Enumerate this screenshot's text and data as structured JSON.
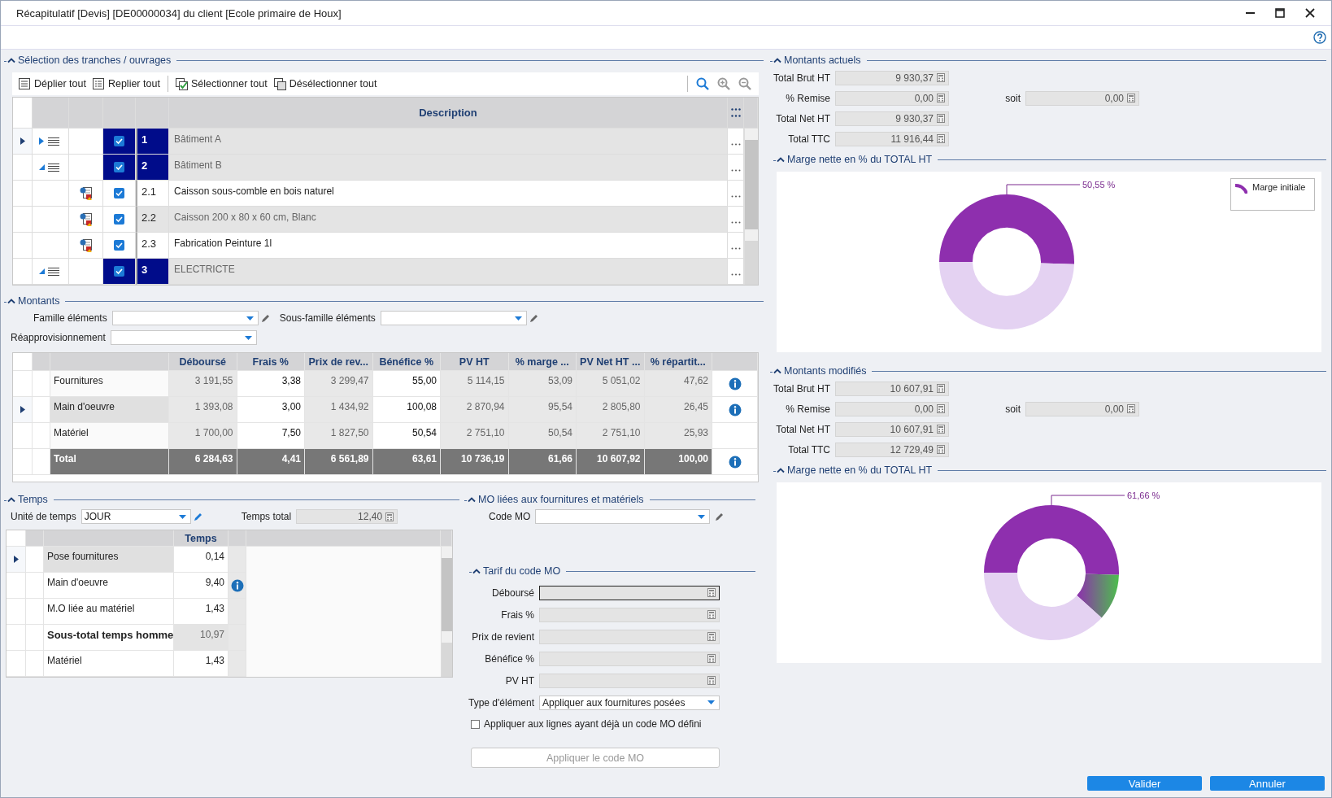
{
  "window": {
    "title": "Récapitulatif [Devis] [DE00000034] du client [Ecole primaire de Houx]"
  },
  "selection": {
    "title": "Sélection des tranches / ouvrages",
    "expanded": true,
    "toolbar": [
      {
        "label": "Déplier tout"
      },
      {
        "label": "Replier tout"
      },
      {
        "label": "Sélectionner tout"
      },
      {
        "label": "Désélectionner tout"
      }
    ],
    "grid": {
      "columns": [
        "Description"
      ],
      "rows": [
        {
          "number": "1",
          "description": "Bâtiment A",
          "kind": "tranche",
          "checked": true,
          "expanded": false,
          "current": true
        },
        {
          "number": "2",
          "description": "Bâtiment B",
          "kind": "tranche",
          "checked": true,
          "expanded": true,
          "current": false,
          "children": [
            {
              "number": "2.1",
              "description": "Caisson sous-comble en bois naturel",
              "kind": "ouvrage",
              "checked": true,
              "current": false
            },
            {
              "number": "2.2",
              "description": "Caisson 200 x 80 x 60 cm, Blanc",
              "kind": "ouvrage",
              "checked": true,
              "current": false
            },
            {
              "number": "2.3",
              "description": "Fabrication Peinture 1l",
              "kind": "ouvrage",
              "checked": true,
              "current": false
            }
          ]
        },
        {
          "number": "3",
          "description": "ELECTRICTE",
          "kind": "tranche",
          "checked": true,
          "expanded": true,
          "current": false
        }
      ]
    }
  },
  "montants": {
    "title": "Montants",
    "expanded": true,
    "filters": [
      {
        "label": "Famille éléments",
        "editable": true
      },
      {
        "label": "Sous-famille éléments",
        "editable": true
      },
      {
        "label": "Réapprovisionnement",
        "editable": false
      }
    ],
    "table": {
      "columns": [
        "Déboursé",
        "Frais %",
        "Prix de rev...",
        "Bénéfice %",
        "PV HT",
        "% marge ...",
        "PV Net HT ...",
        "% répartit..."
      ],
      "rows": [
        {
          "name": "Fournitures",
          "kind": "line",
          "current": false,
          "info": true,
          "values": [
            {
              "text": "3 191,55",
              "editable": false
            },
            {
              "text": "3,38",
              "editable": true
            },
            {
              "text": "3 299,47",
              "editable": false
            },
            {
              "text": "55,00",
              "editable": true
            },
            {
              "text": "5 114,15",
              "editable": false
            },
            {
              "text": "53,09",
              "editable": false
            },
            {
              "text": "5 051,02",
              "editable": false
            },
            {
              "text": "47,62",
              "editable": false
            }
          ]
        },
        {
          "name": "Main d'oeuvre",
          "kind": "line",
          "current": true,
          "info": true,
          "values": [
            {
              "text": "1 393,08",
              "editable": false
            },
            {
              "text": "3,00",
              "editable": true
            },
            {
              "text": "1 434,92",
              "editable": false
            },
            {
              "text": "100,08",
              "editable": true
            },
            {
              "text": "2 870,94",
              "editable": false
            },
            {
              "text": "95,54",
              "editable": false
            },
            {
              "text": "2 805,80",
              "editable": false
            },
            {
              "text": "26,45",
              "editable": false
            }
          ]
        },
        {
          "name": "Matériel",
          "kind": "line",
          "current": false,
          "info": false,
          "values": [
            {
              "text": "1 700,00",
              "editable": false
            },
            {
              "text": "7,50",
              "editable": true
            },
            {
              "text": "1 827,50",
              "editable": false
            },
            {
              "text": "50,54",
              "editable": true
            },
            {
              "text": "2 751,10",
              "editable": false
            },
            {
              "text": "50,54",
              "editable": false
            },
            {
              "text": "2 751,10",
              "editable": false
            },
            {
              "text": "25,93",
              "editable": false
            }
          ]
        },
        {
          "name": "Total",
          "kind": "total",
          "current": false,
          "info": true,
          "values": [
            {
              "text": "6 284,63"
            },
            {
              "text": "4,41"
            },
            {
              "text": "6 561,89"
            },
            {
              "text": "63,61"
            },
            {
              "text": "10 736,19"
            },
            {
              "text": "61,66"
            },
            {
              "text": "10 607,92"
            },
            {
              "text": "100,00"
            }
          ]
        }
      ]
    }
  },
  "temps": {
    "title": "Temps",
    "expanded": true,
    "unit": {
      "label": "Unité de temps",
      "value": "JOUR"
    },
    "total": {
      "label": "Temps total",
      "value": "12,40"
    },
    "table": {
      "column": "Temps",
      "rows": [
        {
          "name": "Pose fournitures",
          "value": "0,14",
          "kind": "line",
          "current": true,
          "info": false
        },
        {
          "name": "Main d'oeuvre",
          "value": "9,40",
          "kind": "line",
          "current": false,
          "info": true
        },
        {
          "name": "M.O liée au matériel",
          "value": "1,43",
          "kind": "line",
          "current": false,
          "info": false
        },
        {
          "name": "Sous-total temps homme",
          "value": "10,97",
          "kind": "subtotal",
          "current": false,
          "info": false
        },
        {
          "name": "Matériel",
          "value": "1,43",
          "kind": "line",
          "current": false,
          "info": false
        }
      ]
    }
  },
  "mo": {
    "title": "MO liées aux fournitures et matériels",
    "expanded": true,
    "code": {
      "label": "Code MO"
    },
    "tarif": {
      "title": "Tarif du code MO",
      "expanded": true,
      "fields": [
        {
          "label": "Déboursé",
          "focused": true
        },
        {
          "label": "Frais %",
          "focused": false
        },
        {
          "label": "Prix de revient",
          "focused": false
        },
        {
          "label": "Bénéfice %",
          "focused": false
        },
        {
          "label": "PV HT",
          "focused": false
        }
      ]
    },
    "type": {
      "label": "Type d'élément",
      "value": "Appliquer aux fournitures posées"
    },
    "option": {
      "label": "Appliquer aux lignes ayant déjà un code MO défini",
      "checked": false
    },
    "apply": {
      "label": "Appliquer le code MO",
      "disabled": true
    }
  },
  "actuels": {
    "title": "Montants actuels",
    "expanded": true,
    "fields": [
      {
        "label": "Total Brut HT",
        "value": "9 930,37"
      },
      {
        "label": "% Remise",
        "value": "0,00",
        "extra": {
          "label": "soit",
          "value": "0,00"
        }
      },
      {
        "label": "Total Net HT",
        "value": "9 930,37"
      },
      {
        "label": "Total TTC",
        "value": "11 916,44"
      }
    ],
    "chart": {
      "title": "Marge nette en % du TOTAL HT",
      "expanded": true,
      "legend": [
        {
          "label": "Marge initiale"
        }
      ],
      "chart_data": {
        "type": "donut",
        "values": [
          50.55,
          49.45
        ],
        "colors": [
          "#8e2fae",
          "#e4d2f2"
        ],
        "annotations": [
          "50,55 %"
        ]
      }
    }
  },
  "modifies": {
    "title": "Montants modifiés",
    "expanded": true,
    "fields": [
      {
        "label": "Total Brut HT",
        "value": "10 607,91"
      },
      {
        "label": "% Remise",
        "value": "0,00",
        "extra": {
          "label": "soit",
          "value": "0,00"
        }
      },
      {
        "label": "Total Net HT",
        "value": "10 607,91"
      },
      {
        "label": "Total TTC",
        "value": "12 729,49"
      }
    ],
    "chart": {
      "title": "Marge nette en % du TOTAL HT",
      "expanded": true,
      "chart_data": {
        "type": "donut",
        "values": [
          50.55,
          11.11,
          38.34
        ],
        "colors": [
          "#8e2fae",
          "#4cbf4c",
          "#e4d2f2"
        ],
        "annotations": [
          "61,66 %"
        ]
      }
    }
  },
  "buttons": [
    {
      "label": "Valider"
    },
    {
      "label": "Annuler"
    }
  ]
}
